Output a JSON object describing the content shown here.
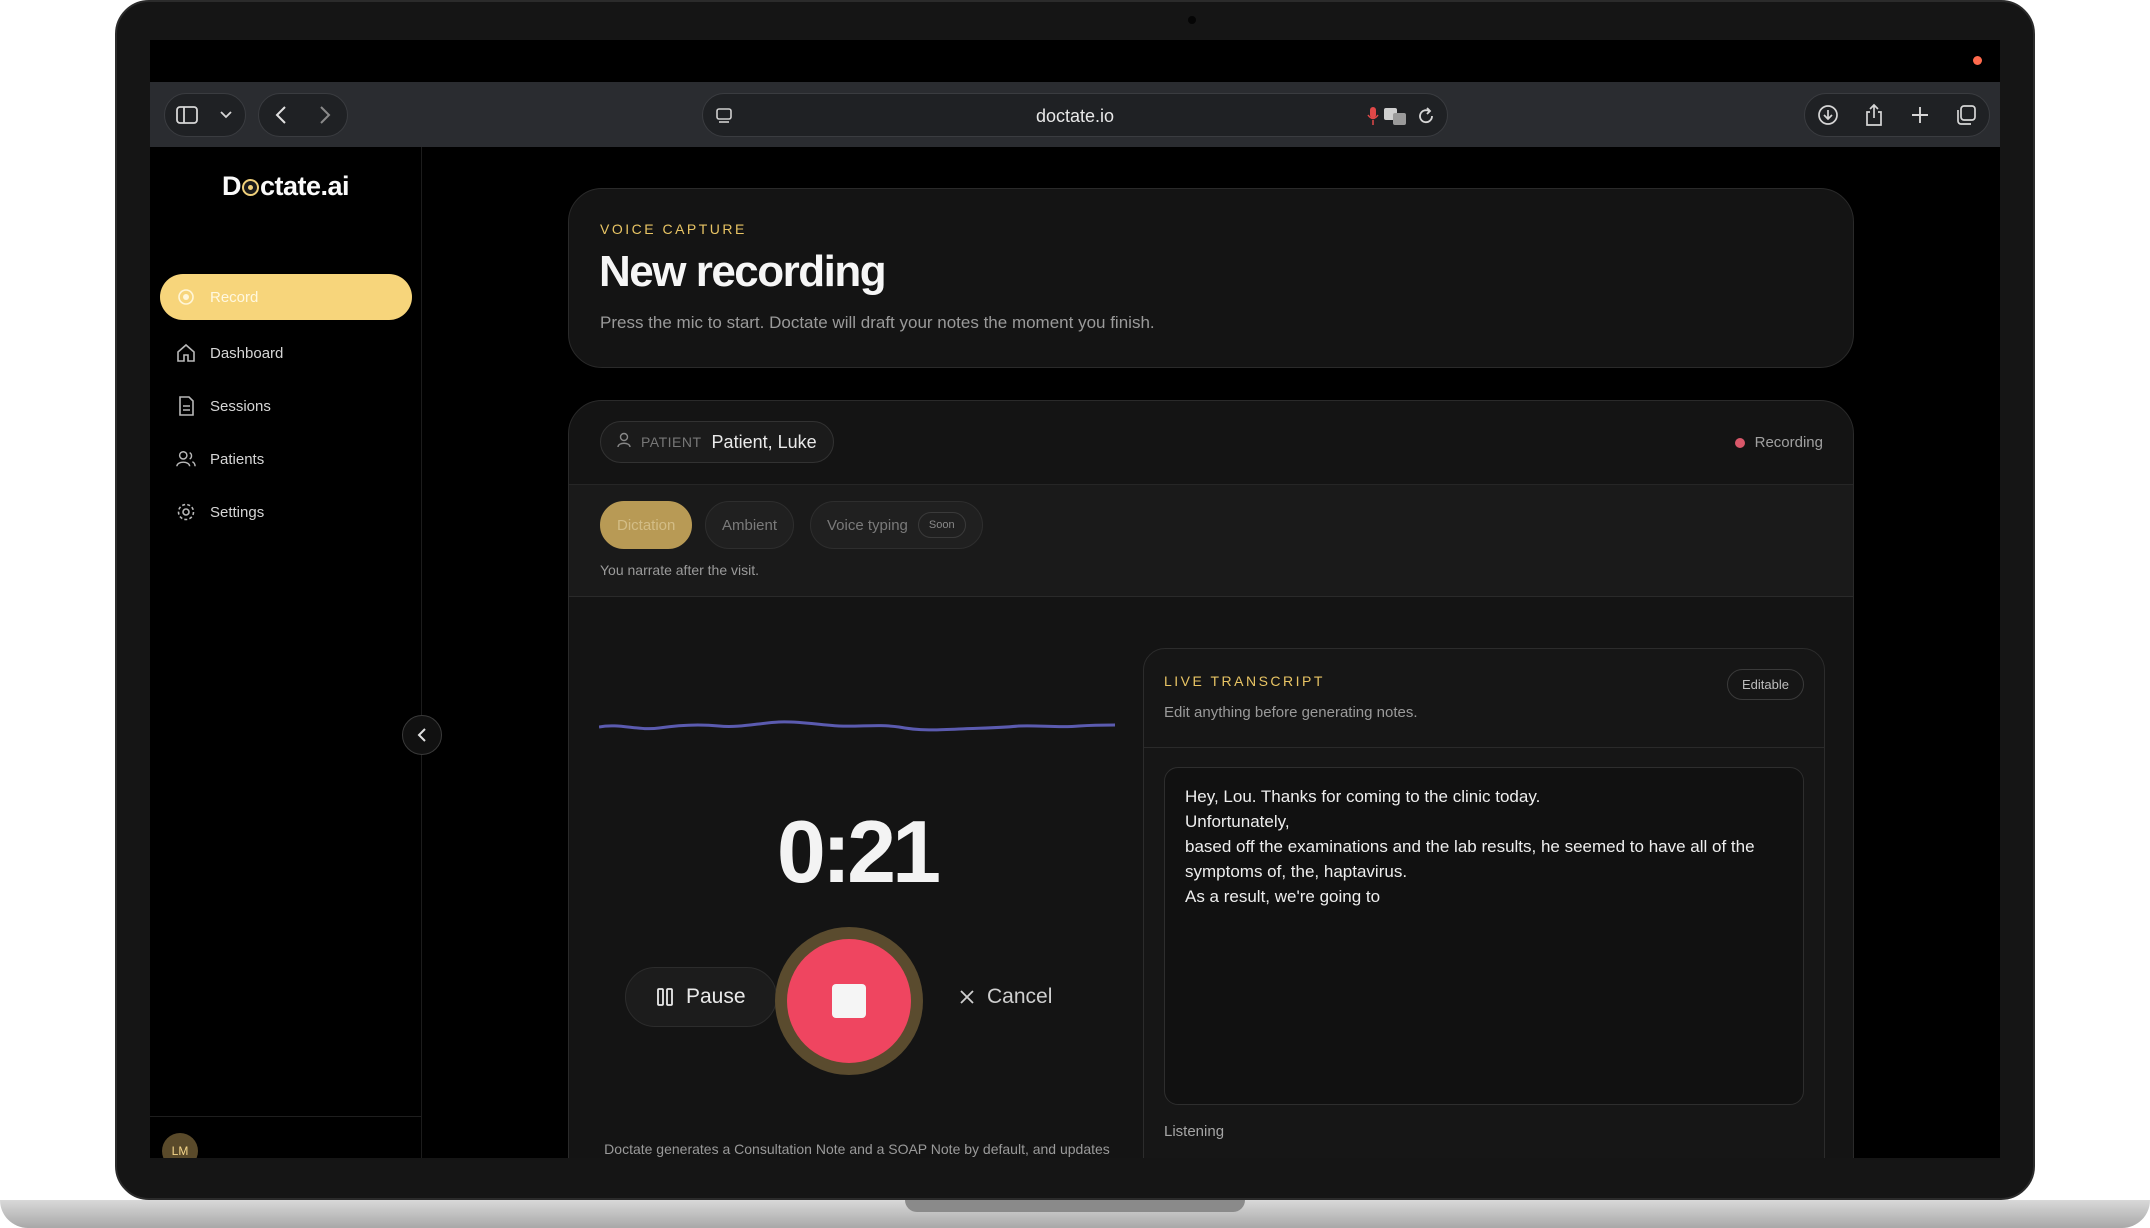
{
  "browser": {
    "url": "doctate.io"
  },
  "app": {
    "logo_prefix": "D",
    "logo_suffix": "ctate.ai"
  },
  "sidebar": {
    "items": [
      {
        "label": "Record",
        "icon": "record-icon"
      },
      {
        "label": "Dashboard",
        "icon": "home-icon"
      },
      {
        "label": "Sessions",
        "icon": "document-icon"
      },
      {
        "label": "Patients",
        "icon": "users-icon"
      },
      {
        "label": "Settings",
        "icon": "gear-icon"
      }
    ],
    "avatar_initials": "LM"
  },
  "header": {
    "eyebrow": "VOICE CAPTURE",
    "title": "New recording",
    "subtitle": "Press the mic to start. Doctate will draft your notes the moment you finish."
  },
  "patient": {
    "label": "PATIENT",
    "name": "Patient, Luke"
  },
  "status": {
    "label": "Recording",
    "color": "#d9586a"
  },
  "modes": {
    "items": [
      {
        "label": "Dictation",
        "active": true
      },
      {
        "label": "Ambient",
        "active": false
      },
      {
        "label": "Voice typing",
        "active": false,
        "badge": "Soon"
      }
    ],
    "hint": "You narrate after the visit."
  },
  "recorder": {
    "timer": "0:21",
    "pause_label": "Pause",
    "cancel_label": "Cancel",
    "footnote": "Doctate generates a Consultation Note and a SOAP Note by default, and updates the patient's longitudinal overview. For best results, include reason for visit, history, assessment, and plan."
  },
  "transcript": {
    "title": "LIVE TRANSCRIPT",
    "subtitle": "Edit anything before generating notes.",
    "badge": "Editable",
    "lines": [
      "Hey, Lou. Thanks for coming to the clinic today.",
      "Unfortunately,",
      "based off the examinations and the lab results, he seemed to have all of the",
      "symptoms of, the, haptavirus.",
      "As a result, we're going to"
    ],
    "status": "Listening"
  },
  "colors": {
    "accent": "#f7d57b",
    "stop_button": "#ef4560",
    "waveform": "#5b5bb0"
  }
}
